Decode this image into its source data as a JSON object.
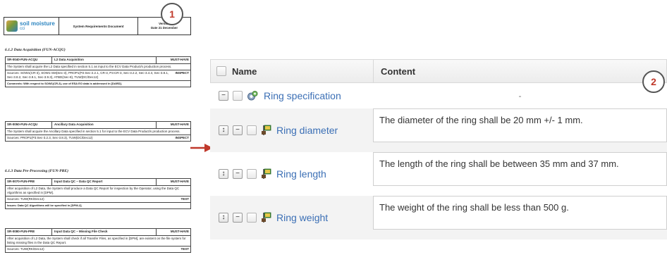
{
  "doc": {
    "logo_main": "soil moisture",
    "logo_sub": "cci",
    "title": "System Requirements Document",
    "version_line": "Version",
    "date_line": "Date 21 December",
    "badge": "1",
    "section_1": "6.1.2  Data Acquisition (FUN-ACQU)",
    "section_2": "6.1.3  Data Pre-Processing (FUN-PRE)",
    "requirements": [
      {
        "id": "SR-0040-FUN-ACQU",
        "title": "L2 Data Acquisition",
        "priority": "MUST-HAVE",
        "text": "The System shall acquire the L2 Data specified in section 5.1 as input to the ECV Data Product/s production process.",
        "sources": "Sources: SOW1(CR-3), SOW1-SM(Sec-3), PROP1(P2:Sec-2.2.1, CR-3, P3:CR-3, Sec-3.2.2, Sec-3.4.3, Sec-3.8.1, Sec-3.8.2, Sec-3.9.1, Sec-3.9.3), ATBD(Sec-8), TUW(DC/Dec12)",
        "verification": "INSPECT",
        "note": "Comments: With respect to SOW1(CR-3), use of ESA EO data is addressed in [DARD]."
      },
      {
        "id": "SR-0050-FUN-ACQU",
        "title": "Ancillary Data Acquisition",
        "priority": "MUST-HAVE",
        "text": "The System shall acquire the Ancillary Data specified in section 5.1 for input to the ECV Data Product/s production process.",
        "sources": "Sources: PROP1(P3:Sec-3.2.3, Sec-3.8.3), TUW(DC/Dec12)",
        "verification": "INSPECT",
        "note": ""
      },
      {
        "id": "SR-0070-FUN-PRE",
        "title": "Input Data QC – Data QC Report",
        "priority": "MUST-HAVE",
        "text": "After acquisition of L2 Data, the System shall produce a Data QC Report for inspection by the Operator, using the Data QC Algorithms as specified in [DPM].",
        "sources": "Sources: TUW(RK/Dec12)",
        "verification": "TEST",
        "note": "Issues: Data QC Algorithms will be specified in [DPM-2]."
      },
      {
        "id": "SR-0080-FUN-PRE",
        "title": "Input Data QC – Missing File Check",
        "priority": "MUST-HAVE",
        "text": "After acquisition of L2 Data, the System shall check if all Transfer Files, as specified in [DPM], are existent on the file system for listing missing files in the Data QC Report.",
        "sources": "Sources: TUW(RK/Dec12)",
        "verification": "TEST",
        "note": ""
      }
    ]
  },
  "grid": {
    "badge": "2",
    "header": {
      "name": "Name",
      "content": "Content"
    },
    "rows": [
      {
        "name": "Ring specification",
        "content": "-"
      },
      {
        "name": "Ring diameter",
        "content": "The diameter of the ring shall be 20 mm +/- 1 mm."
      },
      {
        "name": "Ring length",
        "content": "The length of the ring shall be between 35 mm and 37 mm."
      },
      {
        "name": "Ring weight",
        "content": "The weight of the ring shall be less than 500 g."
      }
    ]
  },
  "colors": {
    "link_blue": "#3b6fb5",
    "badge_red": "#c0392b",
    "arrow_red": "#c0392b"
  }
}
